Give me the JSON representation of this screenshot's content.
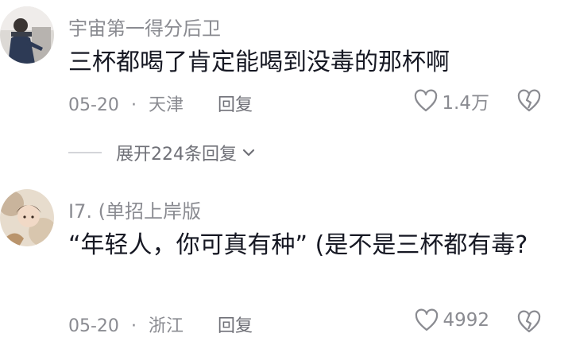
{
  "comments": [
    {
      "username": "宇宙第一得分后卫",
      "text": "三杯都喝了肯定能喝到没毒的那杯啊",
      "date": "05-20",
      "sep": "·",
      "location": "天津",
      "reply_label": "回复",
      "likes": "1.4万",
      "expand_label": "展开224条回复",
      "icons": {
        "like": "heart-outline-icon",
        "dislike": "broken-heart-icon",
        "expand": "chevron-down-icon"
      }
    },
    {
      "username": "I7. (单招上岸版",
      "text": "“年轻人，你可真有种” (是不是三杯都有毒?",
      "date": "05-20",
      "sep": "·",
      "location": "浙江",
      "reply_label": "回复",
      "likes": "4992"
    }
  ],
  "colors": {
    "text": "#161823",
    "secondary": "#8a8b91",
    "background": "#ffffff"
  }
}
